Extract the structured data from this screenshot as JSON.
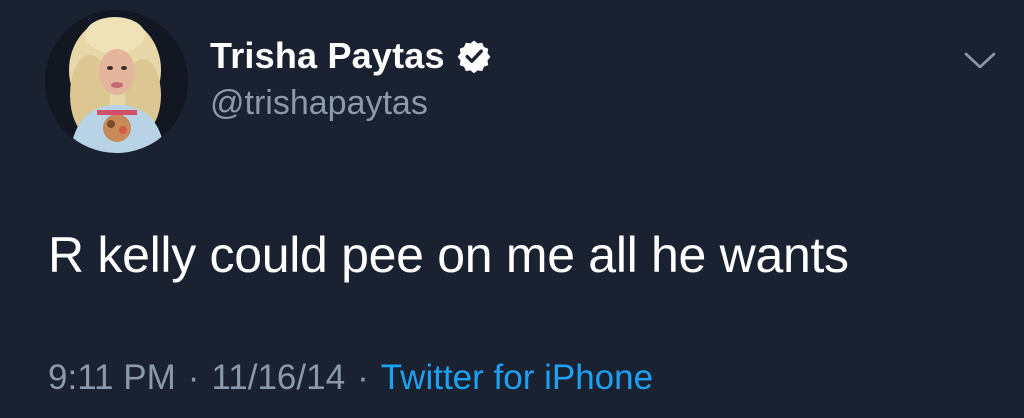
{
  "tweet": {
    "author": {
      "display_name": "Trisha Paytas",
      "handle": "@trishapaytas",
      "verified": true,
      "avatar_icon": "profile-photo"
    },
    "text": "R kelly could pee on me all he wants",
    "time": "9:11 PM",
    "date": "11/16/14",
    "separator": "·",
    "source": "Twitter for iPhone",
    "menu_icon": "chevron-down-icon"
  },
  "colors": {
    "background": "#1a2130",
    "primary_text": "#ffffff",
    "secondary_text": "#8a99ab",
    "link": "#1da1f2",
    "verified_badge": "#ffffff"
  }
}
